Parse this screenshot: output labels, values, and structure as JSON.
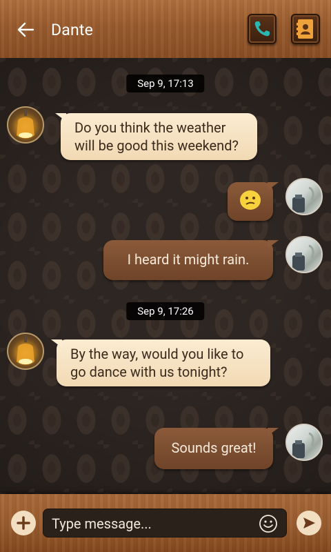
{
  "header": {
    "title": "Dante",
    "back_icon": "arrow-left-icon",
    "call_icon": "phone-icon",
    "contact_icon": "contact-card-icon"
  },
  "chat": {
    "timestamps": [
      "Sep 9, 17:13",
      "Sep 9, 17:26"
    ],
    "messages": [
      {
        "from": "incoming",
        "text": "Do you think the weather will be good this weekend?"
      },
      {
        "from": "outgoing",
        "type": "emoji",
        "emoji": "confused-face"
      },
      {
        "from": "outgoing",
        "text": "I heard it might rain."
      },
      {
        "from": "incoming",
        "text": "By the way, would you like to go dance with us tonight?"
      },
      {
        "from": "outgoing",
        "text": "Sounds great!"
      }
    ]
  },
  "composer": {
    "placeholder": "Type message...",
    "add_icon": "plus-icon",
    "emoji_icon": "smiley-icon",
    "send_icon": "send-icon"
  },
  "colors": {
    "wood": "#9a5c2e",
    "incoming_bubble": "#f6e1c1",
    "outgoing_bubble": "#7c4e30",
    "background": "#2e2622"
  }
}
